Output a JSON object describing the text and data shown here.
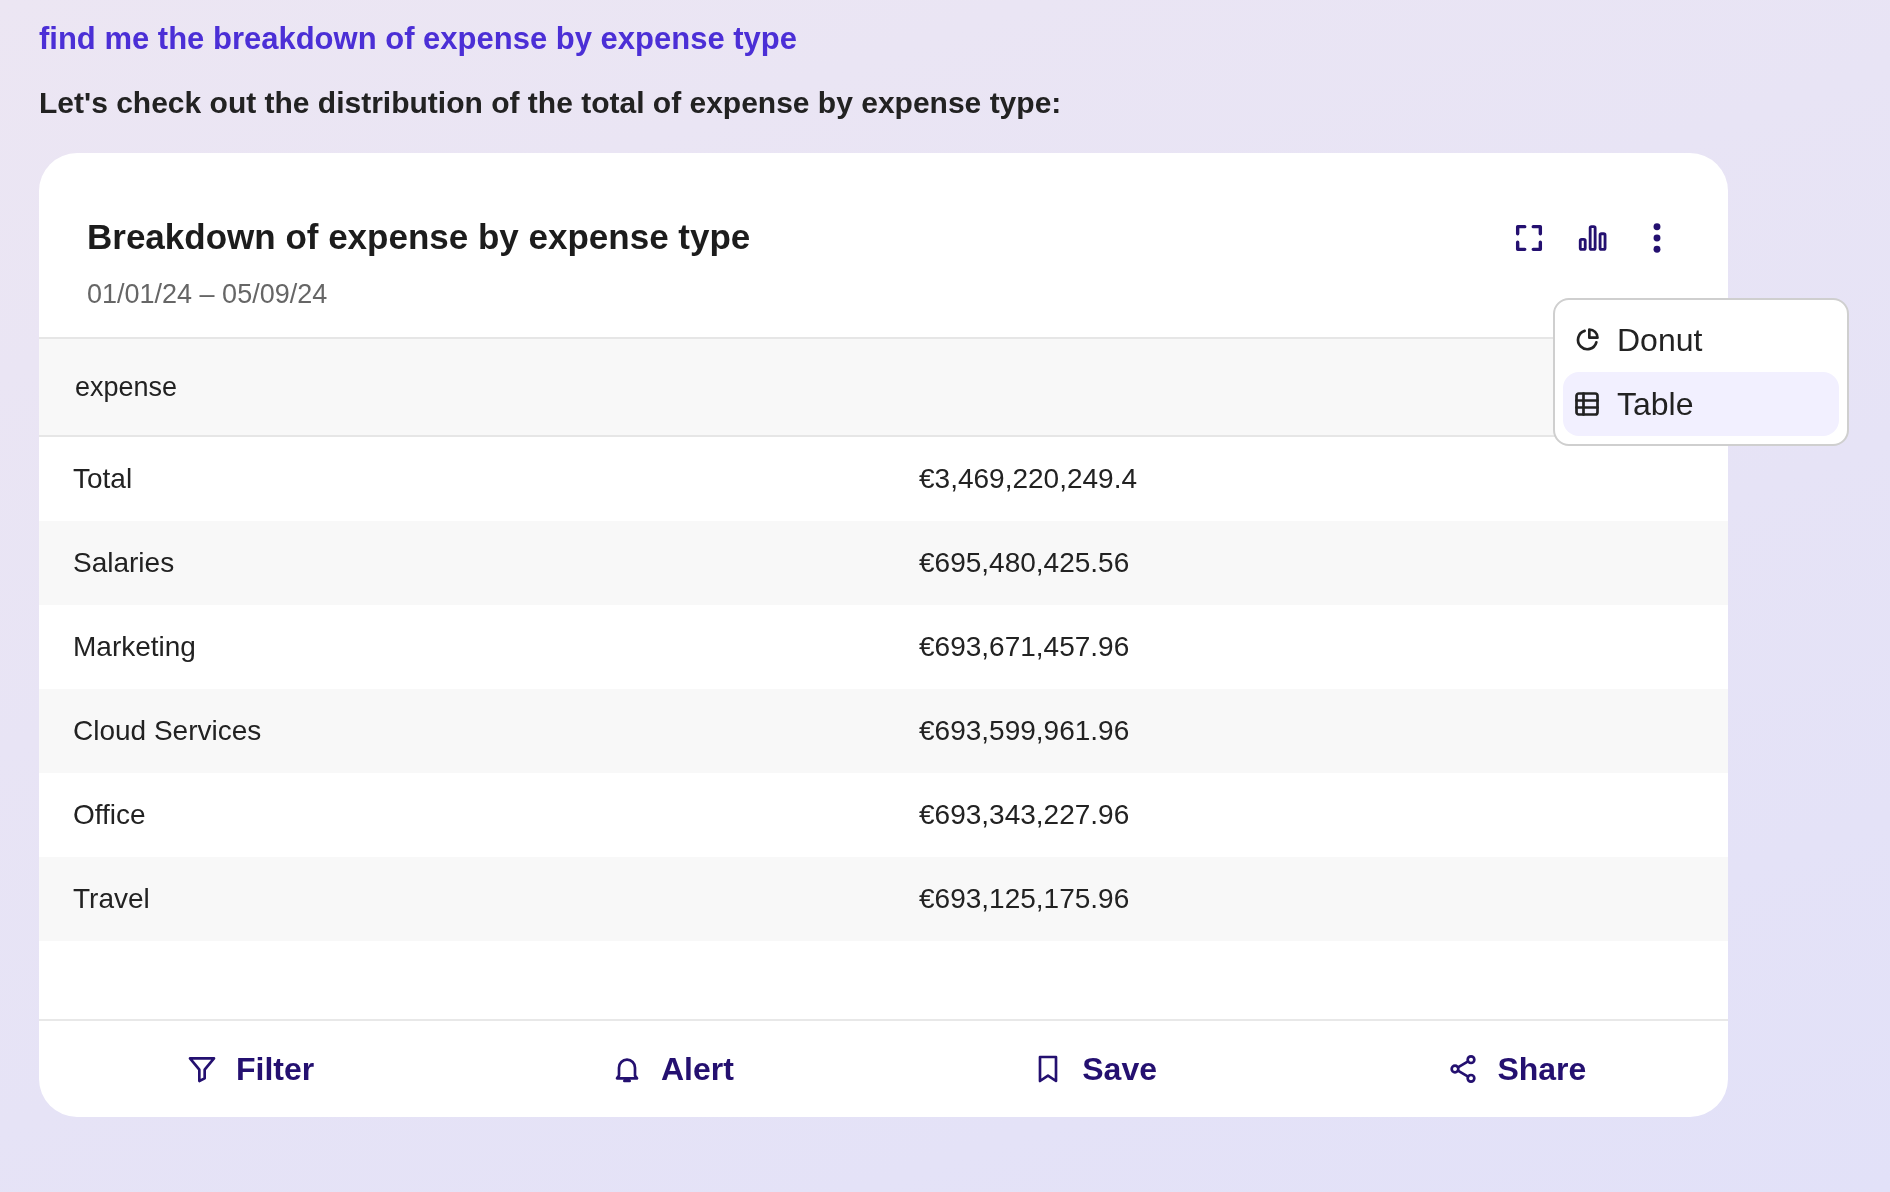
{
  "prompt": "find me the breakdown of expense by expense type",
  "reply": "Let's check out the distribution of the total of expense by expense type:",
  "card": {
    "title": "Breakdown of expense by expense type",
    "date_range": "01/01/24 – 05/09/24",
    "header_icons": [
      {
        "kind": "expand"
      },
      {
        "kind": "chart"
      },
      {
        "kind": "more"
      }
    ],
    "menu": [
      {
        "kind": "donut",
        "label": "Donut",
        "selected": false
      },
      {
        "kind": "table",
        "label": "Table",
        "selected": true
      }
    ],
    "table": {
      "columns": [
        "expense"
      ],
      "rows": [
        [
          "Total",
          "€3,469,220,249.4"
        ],
        [
          "Salaries",
          "€695,480,425.56"
        ],
        [
          "Marketing",
          "€693,671,457.96"
        ],
        [
          "Cloud Services",
          "€693,599,961.96"
        ],
        [
          "Office",
          "€693,343,227.96"
        ],
        [
          "Travel",
          "€693,125,175.96"
        ]
      ]
    },
    "actions": [
      {
        "kind": "filter",
        "label": "Filter"
      },
      {
        "kind": "alert",
        "label": "Alert"
      },
      {
        "kind": "save",
        "label": "Save"
      },
      {
        "kind": "share",
        "label": "Share"
      }
    ]
  }
}
